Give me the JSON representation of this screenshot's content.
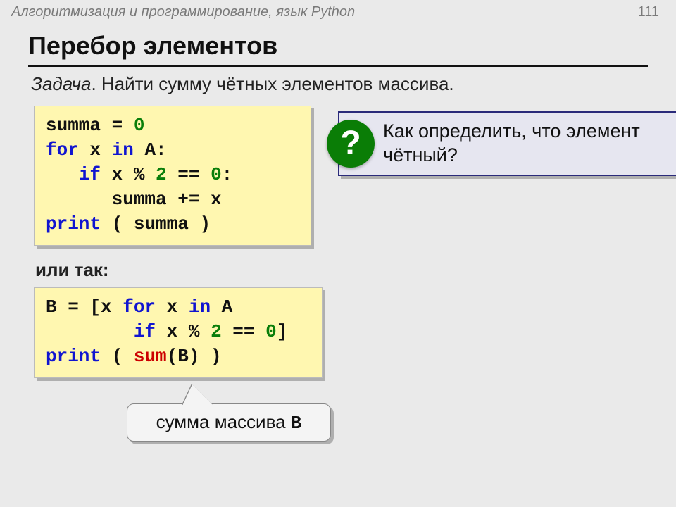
{
  "header": {
    "course": "Алгоритмизация и программирование, язык Python",
    "page": "111"
  },
  "title": "Перебор элементов",
  "problem": {
    "label": "Задача",
    "text": ". Найти сумму чётных элементов массива."
  },
  "code1": {
    "l1a": "summa = ",
    "l1b": "0",
    "l2a": "for",
    "l2b": " x ",
    "l2c": "in",
    "l2d": " A:",
    "l3a": "   if",
    "l3b": " x % ",
    "l3c": "2",
    "l3d": " == ",
    "l3e": "0",
    "l3f": ":",
    "l4": "      summa += x",
    "l5a": "print",
    "l5b": " ( summa )"
  },
  "alt": "или так:",
  "code2": {
    "l1a": "B = [x ",
    "l1b": "for",
    "l1c": " x ",
    "l1d": "in",
    "l1e": " A",
    "l2a": "        ",
    "l2b": "if",
    "l2c": " x % ",
    "l2d": "2",
    "l2e": " == ",
    "l2f": "0",
    "l2g": "]",
    "l3a": "print",
    "l3b": " ( ",
    "l3c": "sum",
    "l3d": "(B) )"
  },
  "question": {
    "badge": "?",
    "text": "Как определить, что элемент чётный?"
  },
  "callout": {
    "text_pre": "сумма массива ",
    "text_mono": "B"
  }
}
